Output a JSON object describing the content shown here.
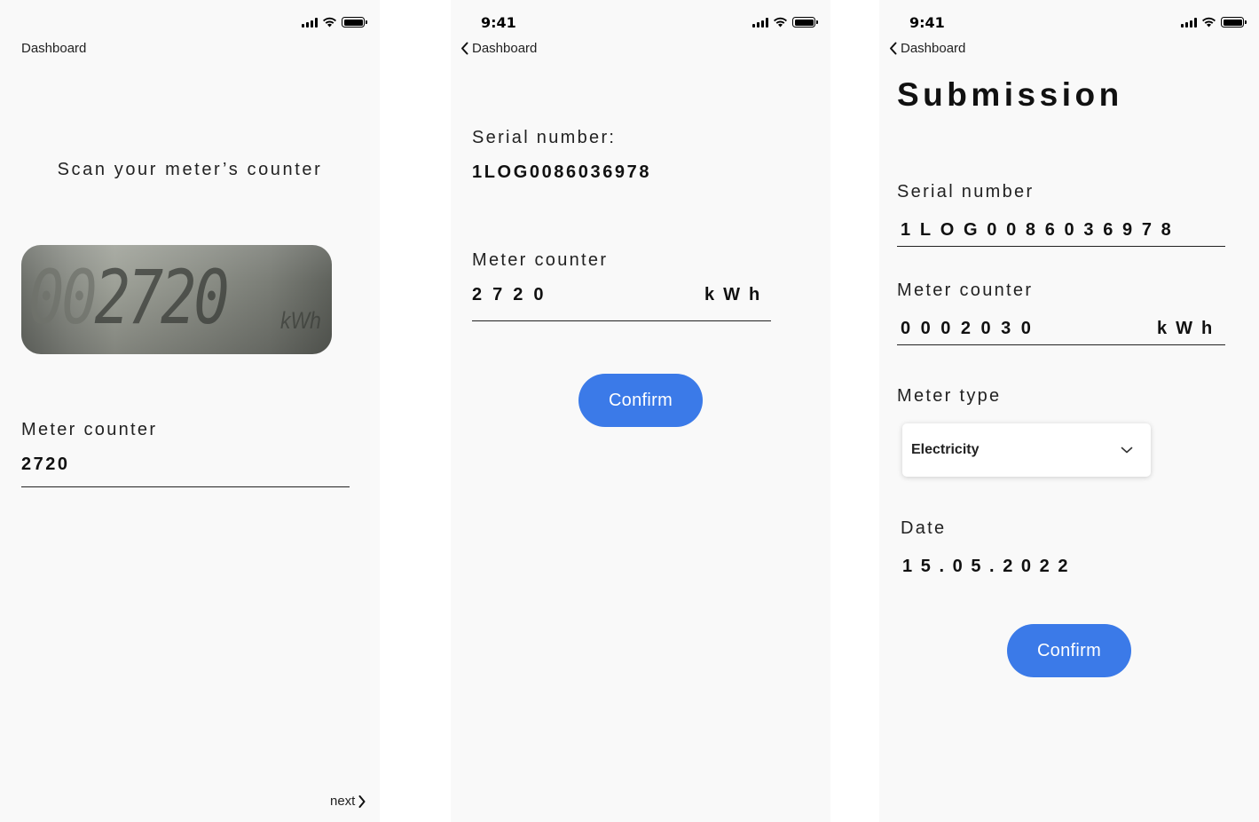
{
  "status_bar": {
    "time": "9:41",
    "signal_icon": "cellular-signal-icon",
    "wifi_icon": "wifi-icon",
    "battery_icon": "battery-icon"
  },
  "colors": {
    "primary": "#3b7ae8",
    "screen_bg": "#f9f9f9",
    "text": "#111111"
  },
  "screen_scan": {
    "back_label": "Dashboard",
    "title": "Scan your meter’s counter",
    "photo": {
      "digits_dim": "00",
      "digits_main": "2720",
      "unit": "kWh"
    },
    "meter_counter_label": "Meter counter",
    "meter_counter_value": "2720",
    "next_label": "next"
  },
  "screen_confirm": {
    "back_label": "Dashboard",
    "serial_label": "Serial number:",
    "serial_value": "1LOG0086036978",
    "meter_counter_label": "Meter counter",
    "meter_counter_value": "2720",
    "unit": "kWh",
    "confirm_label": "Confirm"
  },
  "screen_submission": {
    "back_label": "Dashboard",
    "title": "Submission",
    "serial_label": "Serial number",
    "serial_value": "1LOG0086036978",
    "meter_counter_label": "Meter counter",
    "meter_counter_value": "0002030",
    "unit": "kWh",
    "meter_type_label": "Meter type",
    "meter_type_selected": "Electricity",
    "date_label": "Date",
    "date_value": "15.05.2022",
    "confirm_label": "Confirm"
  }
}
